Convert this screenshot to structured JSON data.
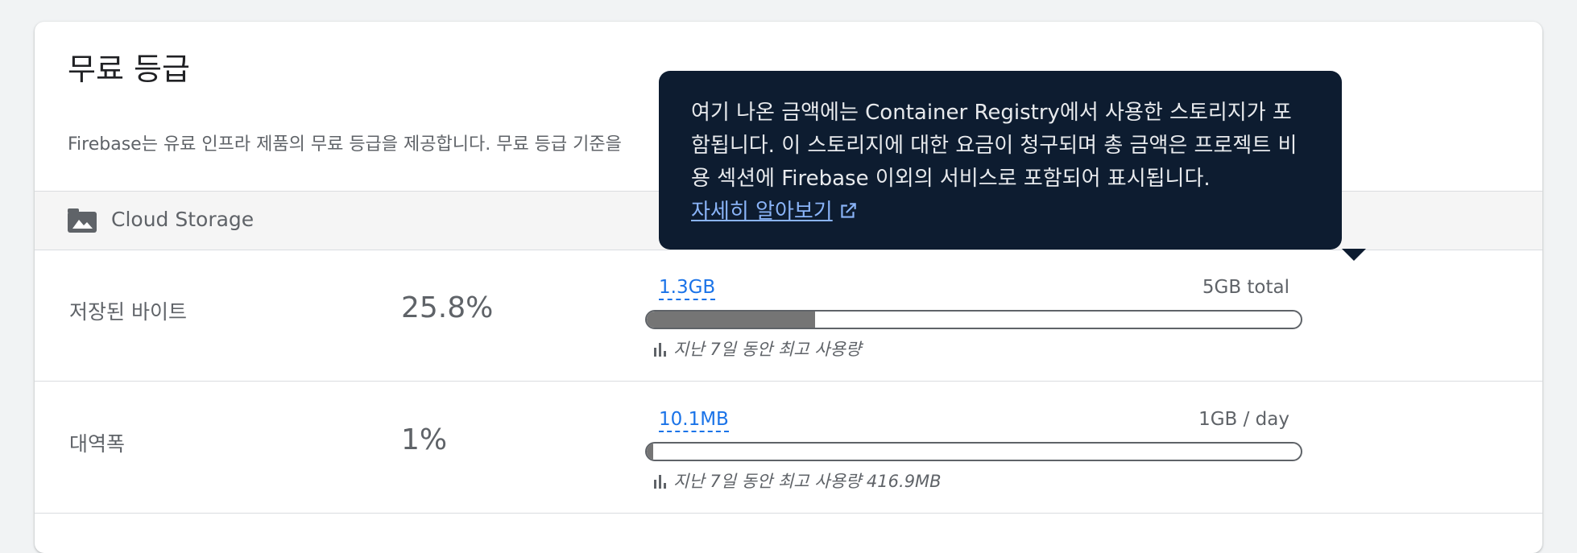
{
  "page": {
    "title": "무료 등급",
    "description": "Firebase는 유료 인프라 제품의 무료 등급을 제공합니다. 무료 등급 기준을"
  },
  "section": {
    "icon": "image-icon",
    "title": "Cloud Storage"
  },
  "rows": [
    {
      "label": "저장된 바이트",
      "percent": "25.8%",
      "usage": "1.3GB",
      "limit": "5GB total",
      "fill_fraction": 0.258,
      "peak_text": "지난 7일 동안 최고 사용량"
    },
    {
      "label": "대역폭",
      "percent": "1%",
      "usage": "10.1MB",
      "limit": "1GB / day",
      "fill_fraction": 0.01,
      "peak_text": "지난 7일 동안 최고 사용량 416.9MB"
    }
  ],
  "tooltip": {
    "text": "여기 나온 금액에는 Container Registry에서 사용한 스토리지가 포함됩니다. 이 스토리지에 대한 요금이 청구되며 총 금액은 프로젝트 비용 섹션에 Firebase 이외의 서비스로 포함되어 표시됩니다.",
    "link_label": "자세히 알아보기",
    "link_icon": "open-in-new-icon"
  },
  "colors": {
    "link_blue": "#1a73e8",
    "tooltip_bg": "#0d1c30",
    "bar_fill": "#757575"
  }
}
